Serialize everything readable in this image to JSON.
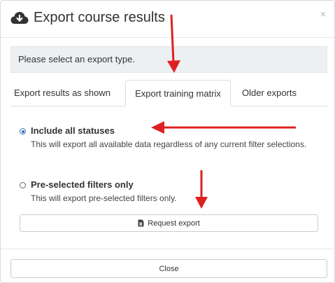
{
  "modal": {
    "title": "Export course results",
    "close_symbol": "×",
    "title_icon": "cloud-download-icon"
  },
  "alert": {
    "text": "Please select an export type."
  },
  "tabs": [
    {
      "label": "Export results as shown",
      "active": false
    },
    {
      "label": "Export training matrix",
      "active": true
    },
    {
      "label": "Older exports",
      "active": false
    }
  ],
  "options": [
    {
      "label": "Include all statuses",
      "description": "This will export all available data regardless of any current filter selections.",
      "checked": true
    },
    {
      "label": "Pre-selected filters only",
      "description": "This will export pre-selected filters only.",
      "checked": false
    }
  ],
  "request_button": {
    "label": "Request export",
    "icon": "file-excel-icon"
  },
  "footer": {
    "close_label": "Close"
  },
  "annotation_color": "#e02020"
}
